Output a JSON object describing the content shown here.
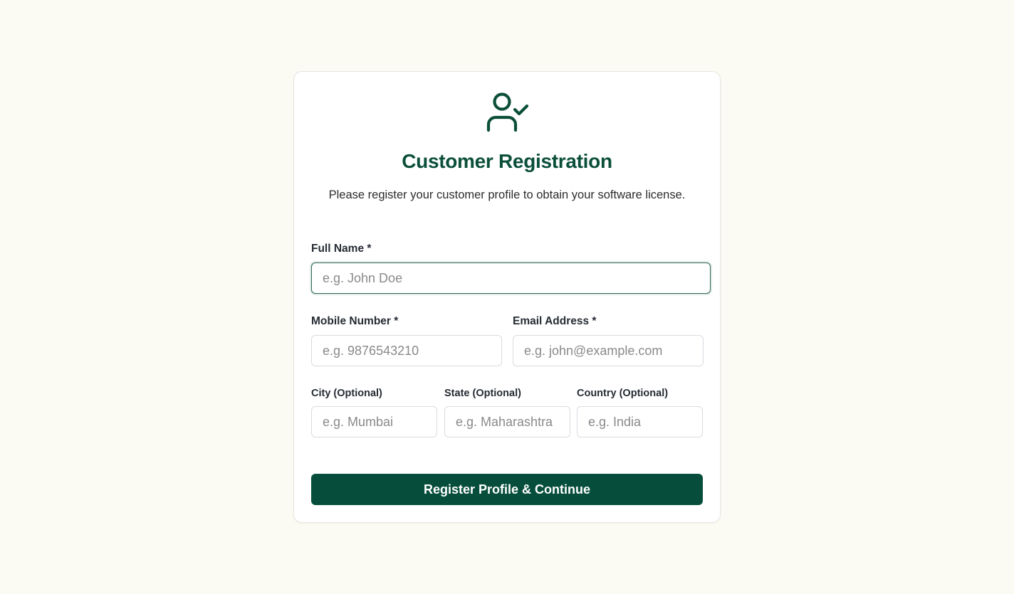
{
  "colors": {
    "background": "#fbfbf4",
    "card": "#ffffff",
    "accent": "#064e3b",
    "title": "#0b4f3a"
  },
  "header": {
    "icon": "user-check-icon",
    "title": "Customer Registration",
    "subtitle": "Please register your customer profile to obtain your software license."
  },
  "form": {
    "full_name": {
      "label": "Full Name *",
      "placeholder": "e.g. John Doe",
      "value": ""
    },
    "mobile": {
      "label": "Mobile Number *",
      "placeholder": "e.g. 9876543210",
      "value": ""
    },
    "email": {
      "label": "Email Address *",
      "placeholder": "e.g. john@example.com",
      "value": ""
    },
    "city": {
      "label": "City (Optional)",
      "placeholder": "e.g. Mumbai",
      "value": ""
    },
    "state": {
      "label": "State (Optional)",
      "placeholder": "e.g. Maharashtra",
      "value": ""
    },
    "country": {
      "label": "Country (Optional)",
      "placeholder": "e.g. India",
      "value": ""
    },
    "submit_label": "Register Profile & Continue"
  }
}
